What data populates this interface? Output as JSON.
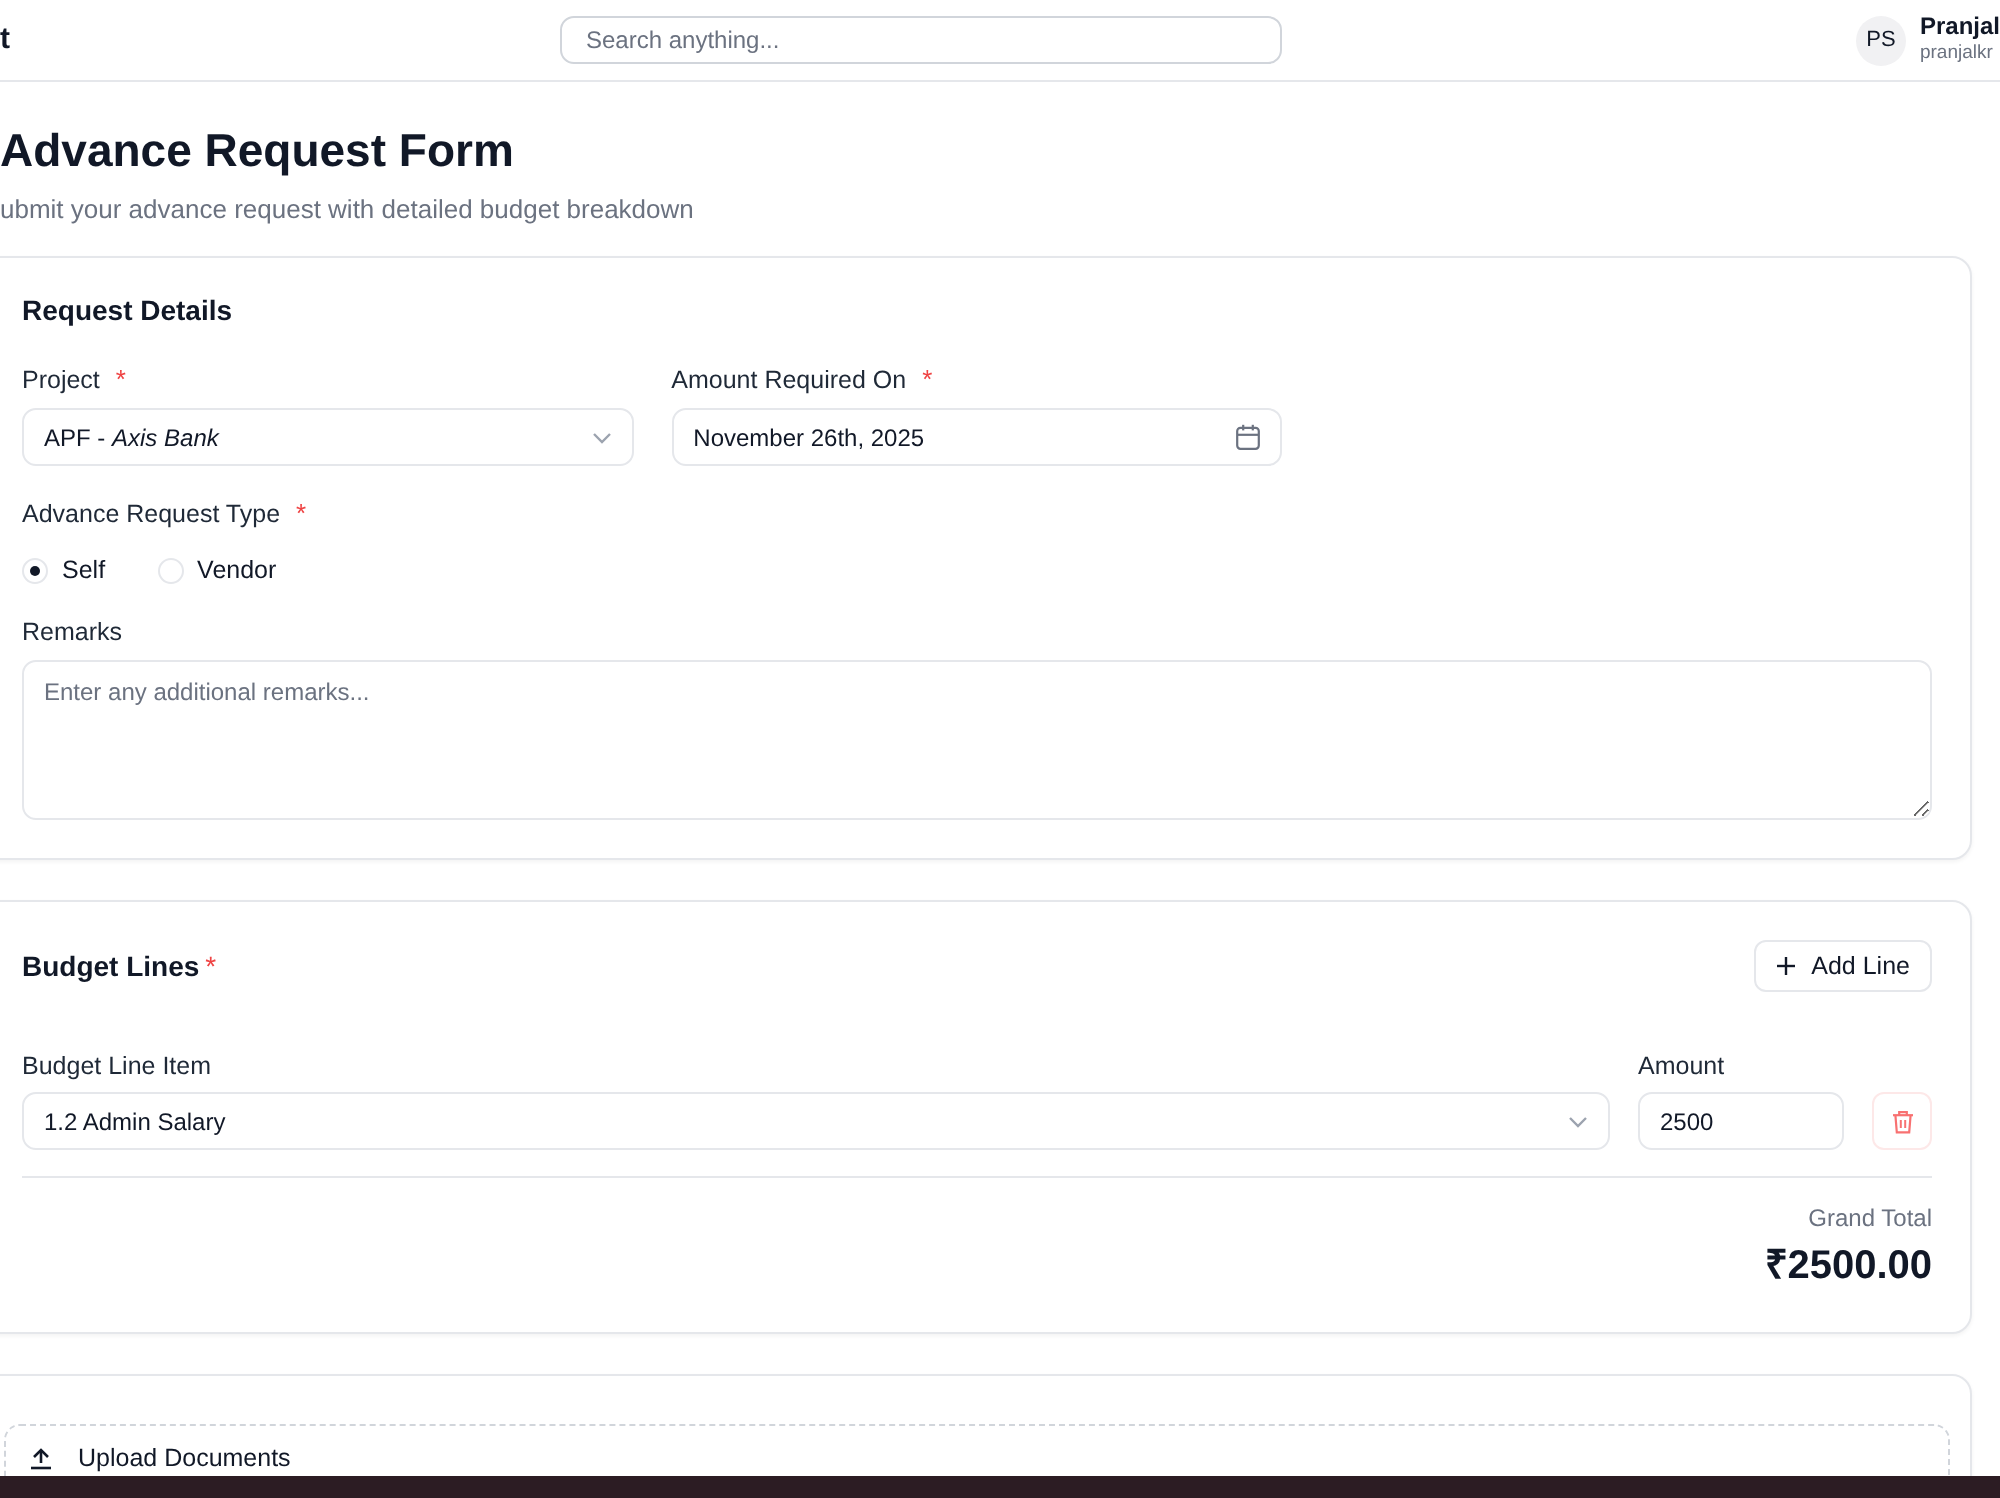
{
  "header": {
    "brand": "t",
    "search": {
      "placeholder": "Search anything..."
    },
    "user": {
      "initials": "PS",
      "name": "Pranjal",
      "email": "pranjalkr"
    }
  },
  "page": {
    "title": "Advance Request Form",
    "subtitle": "ubmit your advance request with detailed budget breakdown"
  },
  "request_details": {
    "title": "Request Details",
    "fields": [
      {
        "kind": "select",
        "label": "Project",
        "required_mark": "*",
        "value": "APF - *Axis Bank*"
      },
      {
        "kind": "date",
        "label": "Amount Required On",
        "required_mark": "*",
        "value": "November 26th, 2025"
      }
    ],
    "request_type": {
      "label": "Advance Request Type",
      "required_mark": "*",
      "options": [
        {
          "label": "Self",
          "selected": true
        },
        {
          "label": "Vendor",
          "selected": false
        }
      ]
    },
    "remarks": {
      "label": "Remarks",
      "placeholder": "Enter any additional remarks..."
    }
  },
  "budget_lines": {
    "title": "Budget Lines",
    "required_mark": "*",
    "add_button": "Add Line",
    "columns": [
      "Budget Line Item",
      "Amount"
    ],
    "rows": [
      {
        "item": "1.2 Admin Salary",
        "amount": "2500"
      }
    ],
    "grand_total_label": "Grand Total",
    "grand_total": "₹2500.00"
  },
  "documents": {
    "title": "Upload Documents"
  }
}
